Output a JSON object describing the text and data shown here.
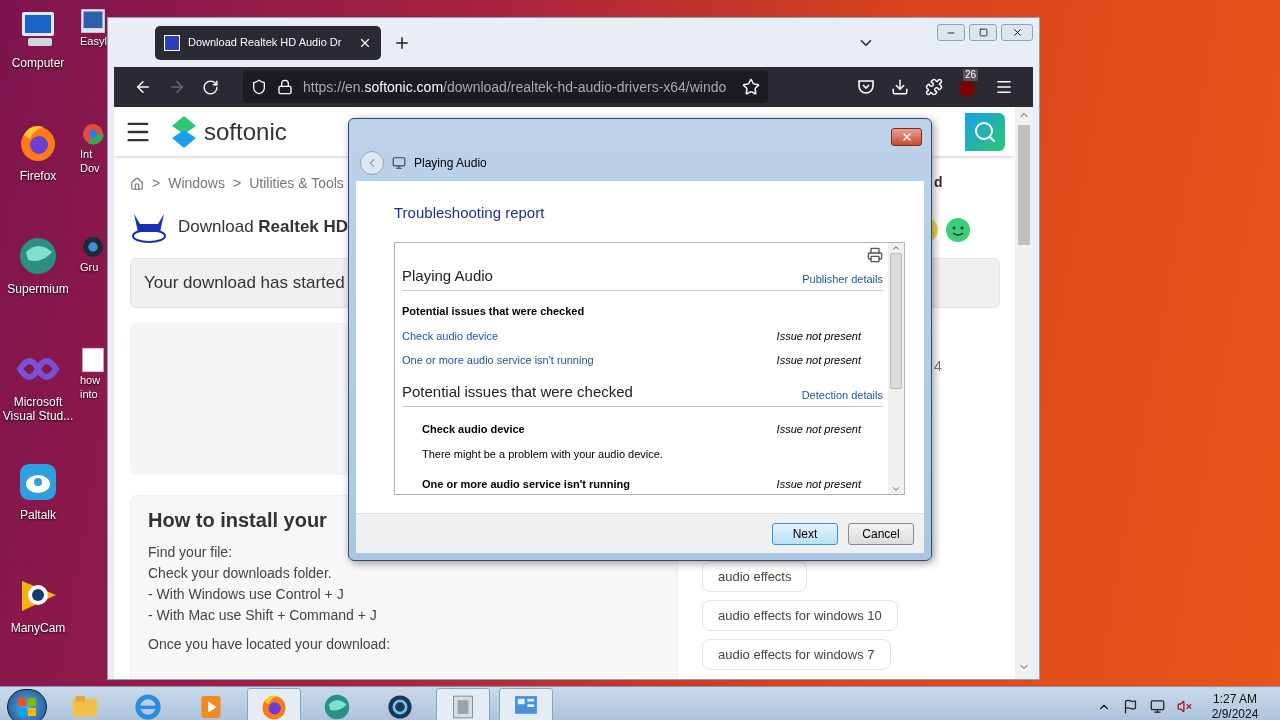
{
  "desktop": {
    "icons": [
      {
        "label": "Computer",
        "kind": "computer"
      },
      {
        "label": "Firefox",
        "kind": "firefox"
      },
      {
        "label": "Supermium",
        "kind": "supermium"
      },
      {
        "label": "Microsoft Visual Stud...",
        "kind": "vs"
      },
      {
        "label": "Paltalk",
        "kind": "paltalk"
      },
      {
        "label": "ManyCam",
        "kind": "manycam"
      }
    ],
    "partial_icons": [
      {
        "lines": [
          "Easyl"
        ],
        "kind": "monitor"
      },
      {
        "lines": [
          "Int",
          "Dov"
        ],
        "kind": "chrome"
      },
      {
        "lines": [
          "Gru"
        ],
        "kind": "dark"
      },
      {
        "lines": [
          "how",
          "into"
        ],
        "kind": "doc"
      }
    ]
  },
  "browser": {
    "tab": {
      "title": "Download Realtek HD Audio Dr",
      "selected": true
    },
    "toolbar": {
      "forward_disabled": true,
      "url_scheme": "https://en.",
      "url_domain": "softonic.com",
      "url_path": "/download/realtek-hd-audio-drivers-x64/windo",
      "ublock_badge": "26"
    },
    "page": {
      "logo": "softonic",
      "breadcrumb": {
        "separator": ">",
        "items": [
          "Windows",
          "Utilities & Tools"
        ]
      },
      "title": "Download **Realtek HD**",
      "notice": "Your download has started",
      "install": {
        "heading": "How to install your",
        "subheading": "Find your file:",
        "lines": [
          "Check your downloads folder.",
          "- With Windows use Control + J",
          "- With Mac use Shift + Command + J"
        ],
        "next": "Once you have located your download:"
      },
      "fragments": [
        "d",
        "4"
      ],
      "tags": [
        "audio effects",
        "audio effects for windows 10",
        "audio effects for windows 7"
      ]
    }
  },
  "dialog": {
    "title": "Playing Audio",
    "heading": "Troubleshooting report",
    "report": {
      "title": "Playing Audio",
      "title_link": "Publisher details",
      "section_heading": "Potential issues that were checked",
      "issues": [
        {
          "name": "Check audio device",
          "status": "Issue not present"
        },
        {
          "name": "One or more audio service isn't running",
          "status": "Issue not present"
        }
      ],
      "details_title": "Potential issues that were checked",
      "details_link": "Detection details",
      "details": [
        {
          "name": "Check audio device",
          "status": "Issue not present",
          "description": "There might be a problem with your audio device."
        },
        {
          "name": "One or more audio service isn't running",
          "status": "Issue not present"
        }
      ]
    },
    "buttons": [
      {
        "label": "Next",
        "default": true
      },
      {
        "label": "Cancel",
        "default": false
      }
    ]
  },
  "taskbar": {
    "apps": [
      {
        "kind": "explorer",
        "selected": false
      },
      {
        "kind": "ie",
        "selected": false
      },
      {
        "kind": "media",
        "selected": false
      },
      {
        "kind": "firefox",
        "selected": true
      },
      {
        "kind": "supermium",
        "selected": false
      },
      {
        "kind": "gear",
        "selected": false
      },
      {
        "kind": "window",
        "selected": true
      },
      {
        "kind": "panel",
        "selected": true
      }
    ],
    "time": "1:27 AM",
    "date": "2/9/2024"
  }
}
